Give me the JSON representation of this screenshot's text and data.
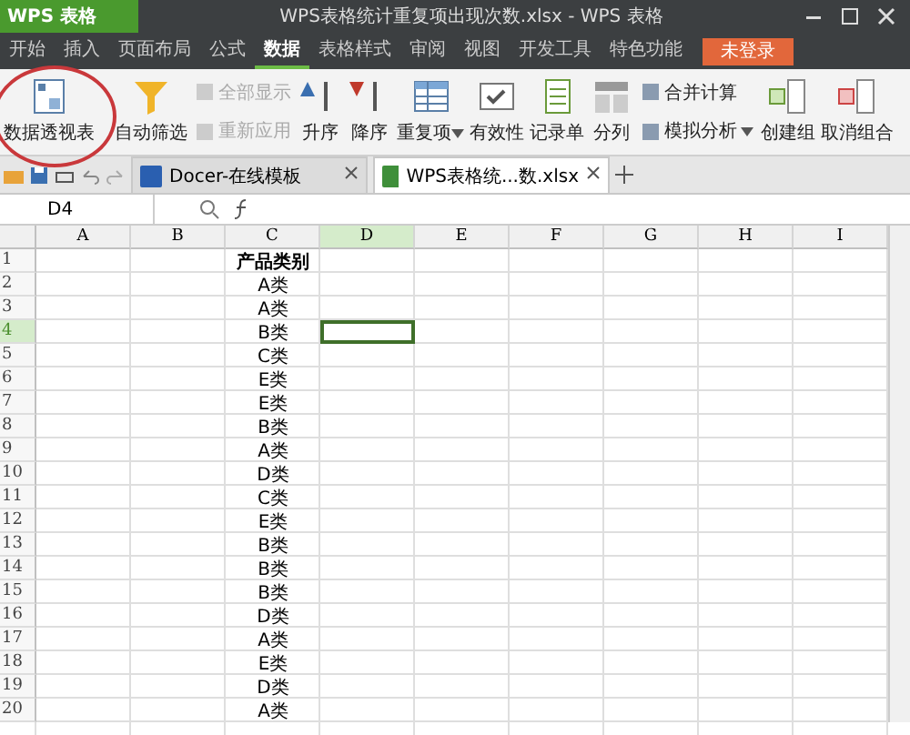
{
  "title_bar": {
    "app_button": "WPS 表格",
    "title": "WPS表格统计重复项出现次数.xlsx - WPS 表格"
  },
  "menu": [
    {
      "label": "开始",
      "selected": false
    },
    {
      "label": "插入",
      "selected": false
    },
    {
      "label": "页面布局",
      "selected": false
    },
    {
      "label": "公式",
      "selected": false
    },
    {
      "label": "数据",
      "selected": true
    },
    {
      "label": "表格样式",
      "selected": false
    },
    {
      "label": "审阅",
      "selected": false
    },
    {
      "label": "视图",
      "selected": false
    },
    {
      "label": "开发工具",
      "selected": false
    },
    {
      "label": "特色功能",
      "selected": false
    }
  ],
  "login_button": "未登录",
  "ribbon": [
    {
      "kind": "large",
      "label": "数据透视表",
      "circled": true
    },
    {
      "kind": "large",
      "label": "自动筛选"
    },
    {
      "kind": "stack",
      "items": [
        {
          "label": "全部显示",
          "disabled": true
        },
        {
          "label": "重新应用",
          "disabled": true
        }
      ]
    },
    {
      "kind": "large",
      "label": "升序"
    },
    {
      "kind": "large",
      "label": "降序"
    },
    {
      "kind": "large",
      "label": "重复项",
      "menu": true
    },
    {
      "kind": "large",
      "label": "有效性"
    },
    {
      "kind": "large",
      "label": "记录单"
    },
    {
      "kind": "large",
      "label": "分列"
    },
    {
      "kind": "stack",
      "items": [
        {
          "label": "合并计算",
          "disabled": false
        },
        {
          "label": "模拟分析",
          "disabled": false,
          "menu": true
        }
      ]
    },
    {
      "kind": "large",
      "label": "创建组"
    },
    {
      "kind": "large",
      "label": "取消组合"
    }
  ],
  "doc_tabs": [
    {
      "label": "Docer-在线模板",
      "selected": false
    },
    {
      "label": "WPS表格统...数.xlsx",
      "selected": true
    }
  ],
  "formula_bar": {
    "cell_ref": "D4"
  },
  "sheet": {
    "columns": [
      {
        "label": "A",
        "selected": false
      },
      {
        "label": "B",
        "selected": false
      },
      {
        "label": "C",
        "selected": false
      },
      {
        "label": "D",
        "selected": true
      },
      {
        "label": "E",
        "selected": false
      },
      {
        "label": "F",
        "selected": false
      },
      {
        "label": "G",
        "selected": false
      },
      {
        "label": "H",
        "selected": false
      },
      {
        "label": "I",
        "selected": false
      }
    ],
    "rows": [
      {
        "number": "1",
        "selected": false,
        "value": "产品类别"
      },
      {
        "number": "2",
        "selected": false,
        "value": "A类"
      },
      {
        "number": "3",
        "selected": false,
        "value": "A类"
      },
      {
        "number": "4",
        "selected": true,
        "value": "B类"
      },
      {
        "number": "5",
        "selected": false,
        "value": "C类"
      },
      {
        "number": "6",
        "selected": false,
        "value": "E类"
      },
      {
        "number": "7",
        "selected": false,
        "value": "E类"
      },
      {
        "number": "8",
        "selected": false,
        "value": "B类"
      },
      {
        "number": "9",
        "selected": false,
        "value": "A类"
      },
      {
        "number": "10",
        "selected": false,
        "value": "D类"
      },
      {
        "number": "11",
        "selected": false,
        "value": "C类"
      },
      {
        "number": "12",
        "selected": false,
        "value": "E类"
      },
      {
        "number": "13",
        "selected": false,
        "value": "B类"
      },
      {
        "number": "14",
        "selected": false,
        "value": "B类"
      },
      {
        "number": "15",
        "selected": false,
        "value": "B类"
      },
      {
        "number": "16",
        "selected": false,
        "value": "D类"
      },
      {
        "number": "17",
        "selected": false,
        "value": "A类"
      },
      {
        "number": "18",
        "selected": false,
        "value": "E类"
      },
      {
        "number": "19",
        "selected": false,
        "value": "D类"
      },
      {
        "number": "20",
        "selected": false,
        "value": "A类"
      }
    ]
  }
}
